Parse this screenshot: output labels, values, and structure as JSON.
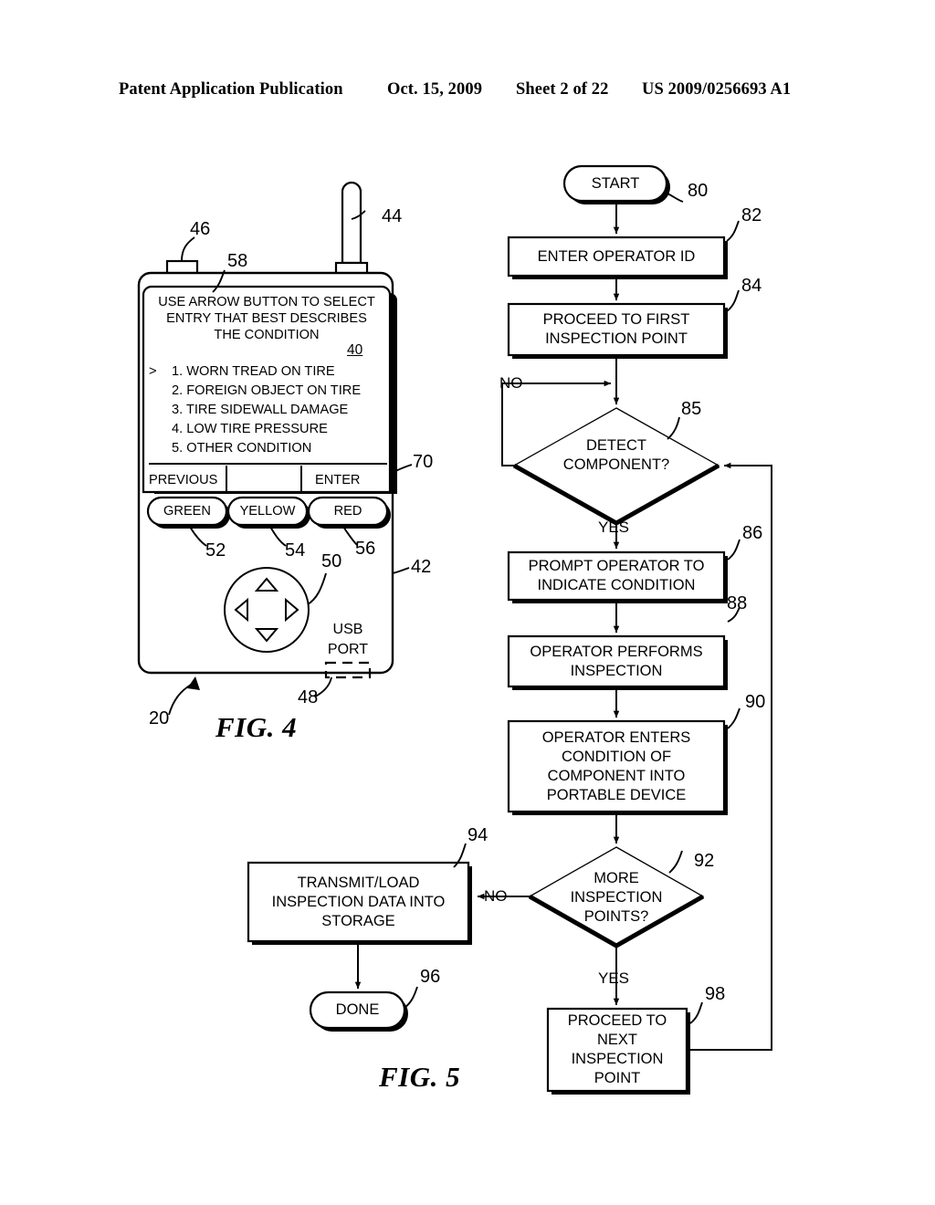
{
  "header": {
    "publication": "Patent Application Publication",
    "date": "Oct. 15, 2009",
    "sheet": "Sheet 2 of 22",
    "patent_number": "US 2009/0256693 A1"
  },
  "fig4": {
    "caption": "FIG. 4",
    "screen": {
      "prompt_line1": "USE ARROW BUTTON TO SELECT",
      "prompt_line2": "ENTRY THAT BEST DESCRIBES",
      "prompt_line3": "THE CONDITION",
      "screen_ref": "40",
      "cursor": ">",
      "options": [
        "1. WORN TREAD ON TIRE",
        "2. FOREIGN OBJECT ON TIRE",
        "3. TIRE SIDEWALL DAMAGE",
        "4. LOW TIRE PRESSURE",
        "5. OTHER CONDITION"
      ],
      "softkey_left": "PREVIOUS",
      "softkey_right": "ENTER"
    },
    "buttons": {
      "green": "GREEN",
      "yellow": "YELLOW",
      "red": "RED"
    },
    "usb_label_line1": "USB",
    "usb_label_line2": "PORT",
    "refs": {
      "device": "20",
      "housing": "42",
      "antenna": "44",
      "nub": "46",
      "usb_port": "48",
      "dpad": "50",
      "green_btn": "52",
      "yellow_btn": "54",
      "red_btn": "56",
      "display": "58",
      "softkey_bar": "70"
    }
  },
  "fig5": {
    "caption": "FIG. 5",
    "nodes": [
      {
        "id": "80",
        "shape": "terminal",
        "text": "START"
      },
      {
        "id": "82",
        "shape": "process",
        "text": "ENTER OPERATOR ID"
      },
      {
        "id": "84",
        "shape": "process",
        "text": "PROCEED TO FIRST\nINSPECTION POINT"
      },
      {
        "id": "85",
        "shape": "decision",
        "text": "DETECT\nCOMPONENT?"
      },
      {
        "id": "86",
        "shape": "process",
        "text": "PROMPT OPERATOR TO\nINDICATE CONDITION"
      },
      {
        "id": "88",
        "shape": "process",
        "text": "OPERATOR PERFORMS\nINSPECTION"
      },
      {
        "id": "90",
        "shape": "process",
        "text": "OPERATOR ENTERS\nCONDITION OF\nCOMPONENT INTO\nPORTABLE DEVICE"
      },
      {
        "id": "92",
        "shape": "decision",
        "text": "MORE\nINSPECTION\nPOINTS?"
      },
      {
        "id": "94",
        "shape": "process",
        "text": "TRANSMIT/LOAD\nINSPECTION DATA INTO\nSTORAGE"
      },
      {
        "id": "96",
        "shape": "terminal",
        "text": "DONE"
      },
      {
        "id": "98",
        "shape": "process",
        "text": "PROCEED TO\nNEXT\nINSPECTION\nPOINT"
      }
    ],
    "edge_labels": {
      "detect_no": "NO",
      "detect_yes": "YES",
      "more_no": "NO",
      "more_yes": "YES"
    }
  }
}
